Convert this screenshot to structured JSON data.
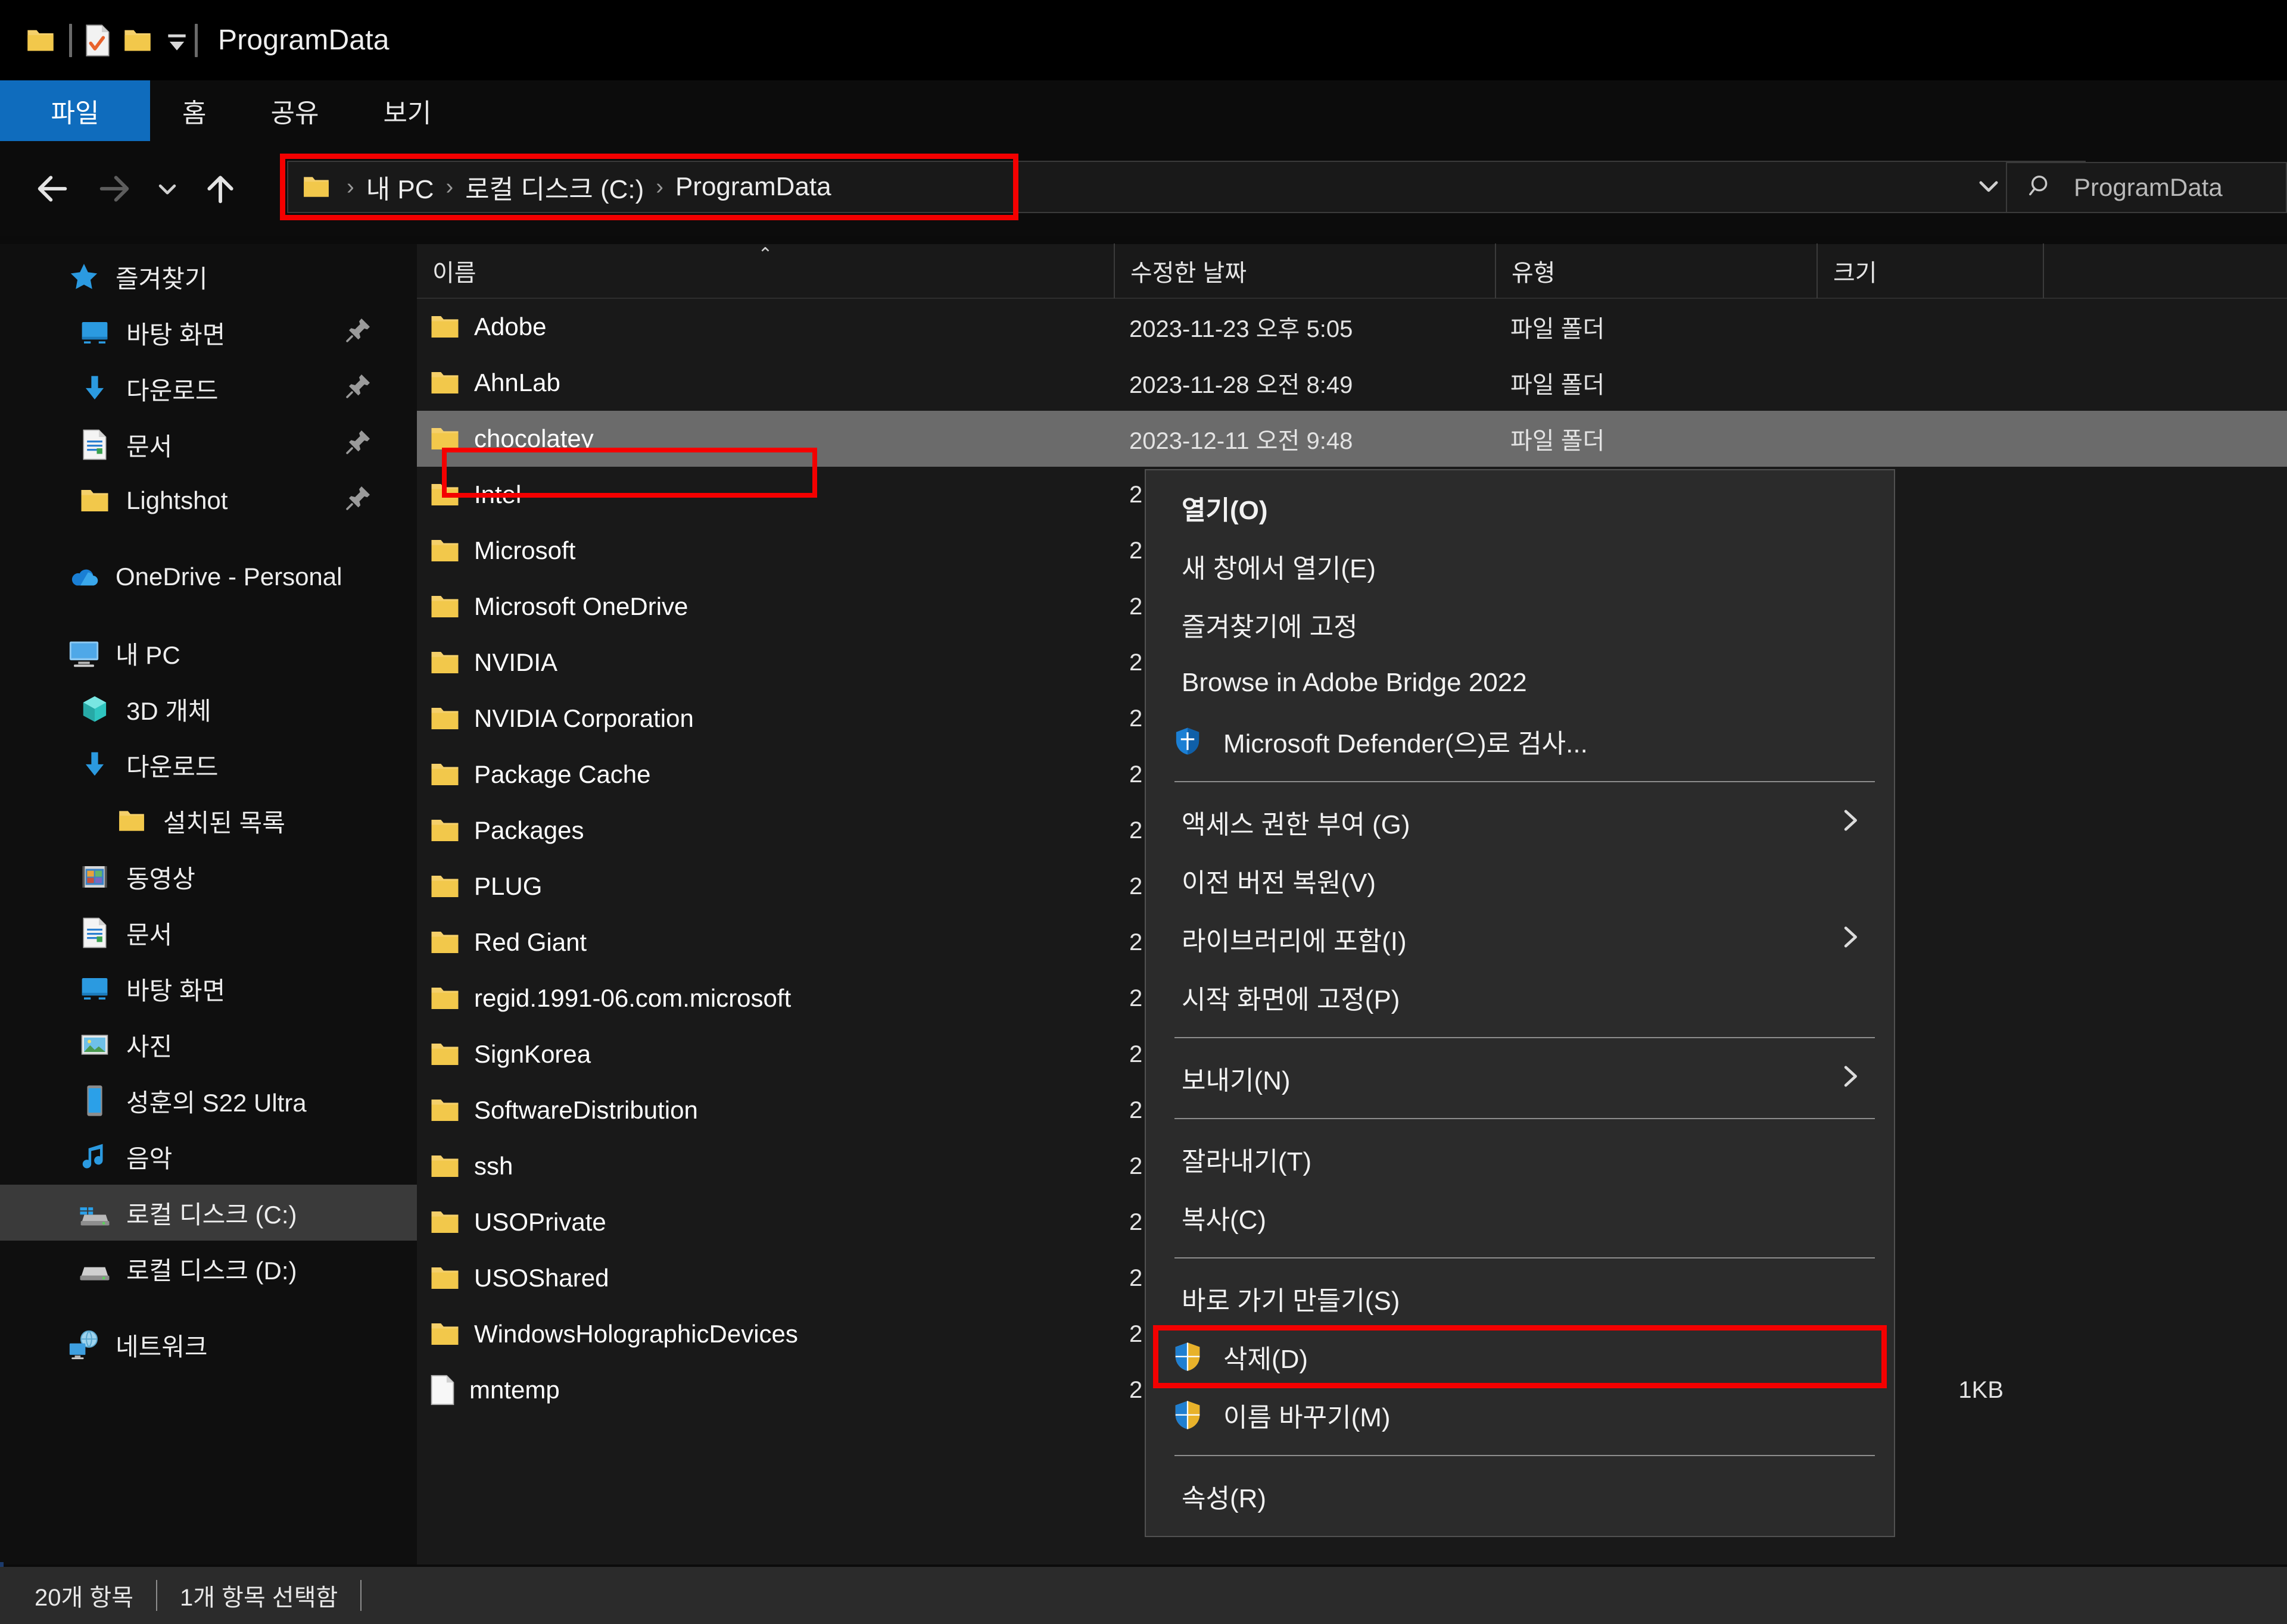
{
  "window": {
    "title": "ProgramData",
    "quick_access_icons": [
      "folder-icon",
      "properties-icon",
      "new-folder-icon",
      "customize-caret-icon"
    ]
  },
  "ribbon": {
    "tabs": [
      {
        "label": "파일",
        "active": true
      },
      {
        "label": "홈",
        "active": false
      },
      {
        "label": "공유",
        "active": false
      },
      {
        "label": "보기",
        "active": false
      }
    ]
  },
  "navigation": {
    "back_icon": "arrow-left-icon",
    "forward_icon": "arrow-right-icon",
    "recent_icon": "chevron-down-icon",
    "up_icon": "arrow-up-icon",
    "breadcrumb": [
      "내 PC",
      "로컬 디스크 (C:)",
      "ProgramData"
    ],
    "breadcrumb_separator": "›",
    "dropdown_icon": "chevron-down-icon",
    "refresh_icon": "refresh-icon"
  },
  "search": {
    "icon": "search-icon",
    "placeholder": "ProgramData"
  },
  "sidebar": {
    "groups": [
      {
        "header": {
          "label": "즐겨찾기",
          "icon": "star-icon"
        },
        "items": [
          {
            "label": "바탕 화면",
            "icon": "desktop-icon",
            "pinned": true,
            "indent": 1
          },
          {
            "label": "다운로드",
            "icon": "download-icon",
            "pinned": true,
            "indent": 1
          },
          {
            "label": "문서",
            "icon": "documents-icon",
            "pinned": true,
            "indent": 1
          },
          {
            "label": "Lightshot",
            "icon": "folder-icon",
            "pinned": true,
            "indent": 1
          }
        ]
      },
      {
        "header": {
          "label": "OneDrive - Personal",
          "icon": "onedrive-cloud-icon"
        },
        "items": []
      },
      {
        "header": {
          "label": "내 PC",
          "icon": "this-pc-icon"
        },
        "items": [
          {
            "label": "3D 개체",
            "icon": "3d-objects-icon",
            "indent": 1
          },
          {
            "label": "다운로드",
            "icon": "download-icon",
            "indent": 1
          },
          {
            "label": "설치된 목록",
            "icon": "folder-icon",
            "indent": 2
          },
          {
            "label": "동영상",
            "icon": "videos-icon",
            "indent": 1
          },
          {
            "label": "문서",
            "icon": "documents-icon",
            "indent": 1
          },
          {
            "label": "바탕 화면",
            "icon": "desktop-icon",
            "indent": 1
          },
          {
            "label": "사진",
            "icon": "pictures-icon",
            "indent": 1
          },
          {
            "label": "성훈의 S22 Ultra",
            "icon": "phone-icon",
            "indent": 1
          },
          {
            "label": "음악",
            "icon": "music-icon",
            "indent": 1
          },
          {
            "label": "로컬 디스크 (C:)",
            "icon": "windows-drive-icon",
            "indent": 1,
            "selected": true
          },
          {
            "label": "로컬 디스크 (D:)",
            "icon": "drive-icon",
            "indent": 1
          }
        ]
      },
      {
        "header": {
          "label": "네트워크",
          "icon": "network-icon"
        },
        "items": []
      }
    ]
  },
  "file_list": {
    "columns": [
      {
        "label": "이름",
        "sorted": "asc",
        "sort_caret": "⌃"
      },
      {
        "label": "수정한 날짜",
        "sorted": null
      },
      {
        "label": "유형",
        "sorted": null
      },
      {
        "label": "크기",
        "sorted": null
      }
    ],
    "rows": [
      {
        "name": "Adobe",
        "icon": "folder-icon",
        "date": "2023-11-23 오후 5:05",
        "type": "파일 폴더",
        "size": ""
      },
      {
        "name": "AhnLab",
        "icon": "folder-icon",
        "date": "2023-11-28 오전 8:49",
        "type": "파일 폴더",
        "size": ""
      },
      {
        "name": "chocolatey",
        "icon": "folder-icon",
        "date": "2023-12-11 오전 9:48",
        "type": "파일 폴더",
        "size": "",
        "selected": true
      },
      {
        "name": "Intel",
        "icon": "folder-icon",
        "date": "2",
        "type": "",
        "size": ""
      },
      {
        "name": "Microsoft",
        "icon": "folder-icon",
        "date": "2",
        "type": "",
        "size": ""
      },
      {
        "name": "Microsoft OneDrive",
        "icon": "folder-icon",
        "date": "2",
        "type": "",
        "size": ""
      },
      {
        "name": "NVIDIA",
        "icon": "folder-icon",
        "date": "2",
        "type": "",
        "size": ""
      },
      {
        "name": "NVIDIA Corporation",
        "icon": "folder-icon",
        "date": "2",
        "type": "",
        "size": ""
      },
      {
        "name": "Package Cache",
        "icon": "folder-icon",
        "date": "2",
        "type": "",
        "size": ""
      },
      {
        "name": "Packages",
        "icon": "folder-icon",
        "date": "2",
        "type": "",
        "size": ""
      },
      {
        "name": "PLUG",
        "icon": "folder-icon",
        "date": "2",
        "type": "",
        "size": ""
      },
      {
        "name": "Red Giant",
        "icon": "folder-icon",
        "date": "2",
        "type": "",
        "size": ""
      },
      {
        "name": "regid.1991-06.com.microsoft",
        "icon": "folder-icon",
        "date": "2",
        "type": "",
        "size": ""
      },
      {
        "name": "SignKorea",
        "icon": "folder-icon",
        "date": "2",
        "type": "",
        "size": ""
      },
      {
        "name": "SoftwareDistribution",
        "icon": "folder-icon",
        "date": "2",
        "type": "",
        "size": ""
      },
      {
        "name": "ssh",
        "icon": "folder-icon",
        "date": "2",
        "type": "",
        "size": ""
      },
      {
        "name": "USOPrivate",
        "icon": "folder-icon",
        "date": "2",
        "type": "",
        "size": ""
      },
      {
        "name": "USOShared",
        "icon": "folder-icon",
        "date": "2",
        "type": "",
        "size": ""
      },
      {
        "name": "WindowsHolographicDevices",
        "icon": "folder-icon",
        "date": "2",
        "type": "",
        "size": ""
      },
      {
        "name": "mntemp",
        "icon": "file-icon",
        "date": "2",
        "type": "",
        "size": "1KB"
      }
    ]
  },
  "context_menu": {
    "items": [
      {
        "label": "열기(O)",
        "bold": true
      },
      {
        "label": "새 창에서 열기(E)"
      },
      {
        "label": "즐겨찾기에 고정"
      },
      {
        "label": "Browse in Adobe Bridge 2022"
      },
      {
        "label": "Microsoft Defender(으)로 검사...",
        "icon": "defender-shield-icon"
      },
      {
        "divider": true
      },
      {
        "label": "액세스 권한 부여 (G)",
        "submenu": true
      },
      {
        "label": "이전 버전 복원(V)"
      },
      {
        "label": "라이브러리에 포함(I)",
        "submenu": true
      },
      {
        "label": "시작 화면에 고정(P)"
      },
      {
        "divider": true
      },
      {
        "label": "보내기(N)",
        "submenu": true
      },
      {
        "divider": true
      },
      {
        "label": "잘라내기(T)"
      },
      {
        "label": "복사(C)"
      },
      {
        "divider": true
      },
      {
        "label": "바로 가기 만들기(S)"
      },
      {
        "label": "삭제(D)",
        "icon": "uac-shield-icon",
        "highlighted": true
      },
      {
        "label": "이름 바꾸기(M)",
        "icon": "uac-shield-icon"
      },
      {
        "divider": true
      },
      {
        "label": "속성(R)"
      }
    ]
  },
  "status_bar": {
    "item_count": "20개 항목",
    "selection": "1개 항목 선택함"
  },
  "annotations": {
    "color": "#f40000",
    "targets": [
      "address-bar",
      "chocolatey-row",
      "delete-menu-item"
    ]
  }
}
